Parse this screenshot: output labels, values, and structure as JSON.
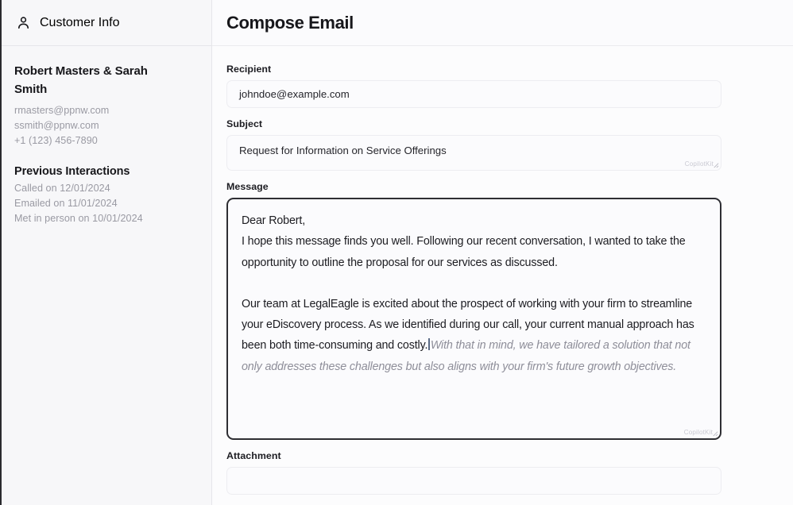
{
  "sidebar": {
    "header": {
      "icon": "person-icon",
      "title": "Customer Info"
    },
    "customer": {
      "name": "Robert Masters & Sarah Smith",
      "contacts": [
        "rmasters@ppnw.com",
        "ssmith@ppnw.com",
        "+1 (123) 456-7890"
      ]
    },
    "previous_interactions": {
      "title": "Previous Interactions",
      "items": [
        "Called on 12/01/2024",
        "Emailed on 11/01/2024",
        "Met in person on 10/01/2024"
      ]
    }
  },
  "main": {
    "title": "Compose Email",
    "fields": {
      "recipient": {
        "label": "Recipient",
        "value": "johndoe@example.com",
        "placeholder": "johndoe@example.com"
      },
      "subject": {
        "label": "Subject",
        "value": "Request for Information on Service Offerings",
        "placeholder": "Request for Information on Service Offerings",
        "watermark": "CopilotKit"
      },
      "message": {
        "label": "Message",
        "watermark": "CopilotKit",
        "paragraph_1_line_1": "Dear Robert,",
        "paragraph_1_line_2": "I hope this message finds you well. Following our recent conversation, I wanted to take the opportunity to outline the proposal for our services as discussed.",
        "paragraph_2": "Our team at LegalEagle is excited about the prospect of working with your firm to streamline your eDiscovery process. As we identified during our call, your current manual approach has been both time-consuming and costly.",
        "suggestion": "With that in mind, we have tailored a solution that not only addresses these challenges but also aligns with your firm's future growth objectives."
      },
      "attachment": {
        "label": "Attachment",
        "value": ""
      }
    }
  },
  "colors": {
    "text_primary": "#17171b",
    "text_muted": "#9a9aa3",
    "suggestion": "#8e8e99",
    "focus_border": "#2e2e33",
    "sidebar_bg": "#f7f7f9",
    "caret": "#5b6b86"
  }
}
